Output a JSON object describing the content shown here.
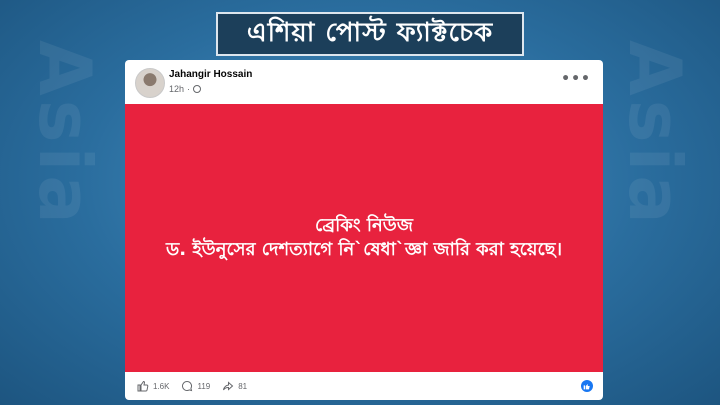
{
  "banner": {
    "title": "এশিয়া পোস্ট ফ্যাক্টচেক"
  },
  "watermark": {
    "text": "Asia post"
  },
  "post": {
    "author": "Jahangir Hossain",
    "time": "12h",
    "audience_icon": "globe-icon",
    "menu_icon": "more-dots-icon",
    "headline_line1": "ব্রেকিং নিউজ",
    "headline_line2": "ড. ইউনুসের দেশত্যাগে নি`ষেধা`জ্ঞা জারি করা হয়েছে।",
    "background_color": "#e8223e"
  },
  "stats": {
    "likes": "1.6K",
    "comments": "119",
    "shares": "81"
  },
  "colors": {
    "banner_bg": "#1c3f5a",
    "accent": "#1877f2"
  }
}
